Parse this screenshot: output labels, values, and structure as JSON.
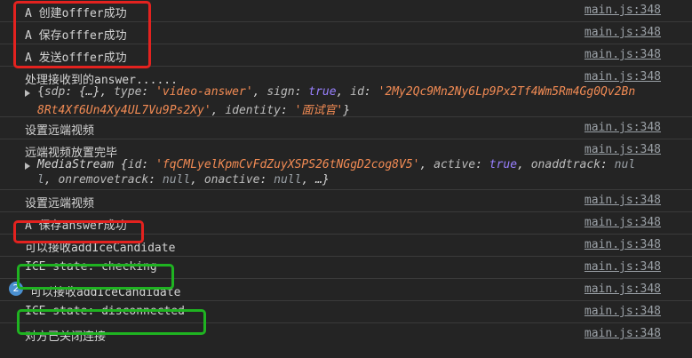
{
  "source_link": "main.js:348",
  "logs": {
    "r1": "A 创建offfer成功",
    "r2": "A 保存offfer成功",
    "r3": "A 发送offfer成功",
    "r4_l1": "处理接收到的answer......",
    "r4_l2_prefix": "{",
    "r4_sdp_key": "sdp",
    "r4_sdp_val": "{…}",
    "r4_type_key": "type",
    "r4_type_val": "'video-answer'",
    "r4_sign_key": "sign",
    "r4_sign_val": "true",
    "r4_id_key": "id",
    "r4_id_val_a": "'2My2Qc9Mn2Ny6Lp9Px2Tf4Wm5Rm4Gg0Qv2Bn",
    "r4_id_val_b": "8Rt4Xf6Un4Xy4UL7Vu9Ps2Xy'",
    "r4_identity_key": "identity",
    "r4_identity_val": "'面试官'",
    "r5": "设置远端视频",
    "r6_l1": "远端视频放置完毕",
    "r6_obj": "MediaStream",
    "r6_id_key": "id",
    "r6_id_val": "'fqCMLyelKpmCvFdZuyXSPS26tNGgD2cog8V5'",
    "r6_active_key": "active",
    "r6_active_val": "true",
    "r6_onadd_key": "onaddtrack",
    "r6_onadd_val_a": "nul",
    "r6_onadd_val_b": "l",
    "r6_onremove_key": "onremovetrack",
    "r6_onremove_val": "null",
    "r6_onactive_key": "onactive",
    "r6_onactive_val": "null",
    "r6_more": "…}",
    "r7": "设置远端视频",
    "r8": "A 保存answer成功",
    "r9": "可以接收addIceCandidate",
    "r10": "ICE state: checking",
    "r11_badge": "2",
    "r11": "可以接收addIceCandidate",
    "r12": "ICE state: disconnected",
    "r13": "对方已关闭连接"
  },
  "colors": {
    "highlight_red": "#e3221f",
    "highlight_green": "#1fb321",
    "badge": "#4a8fd0"
  }
}
